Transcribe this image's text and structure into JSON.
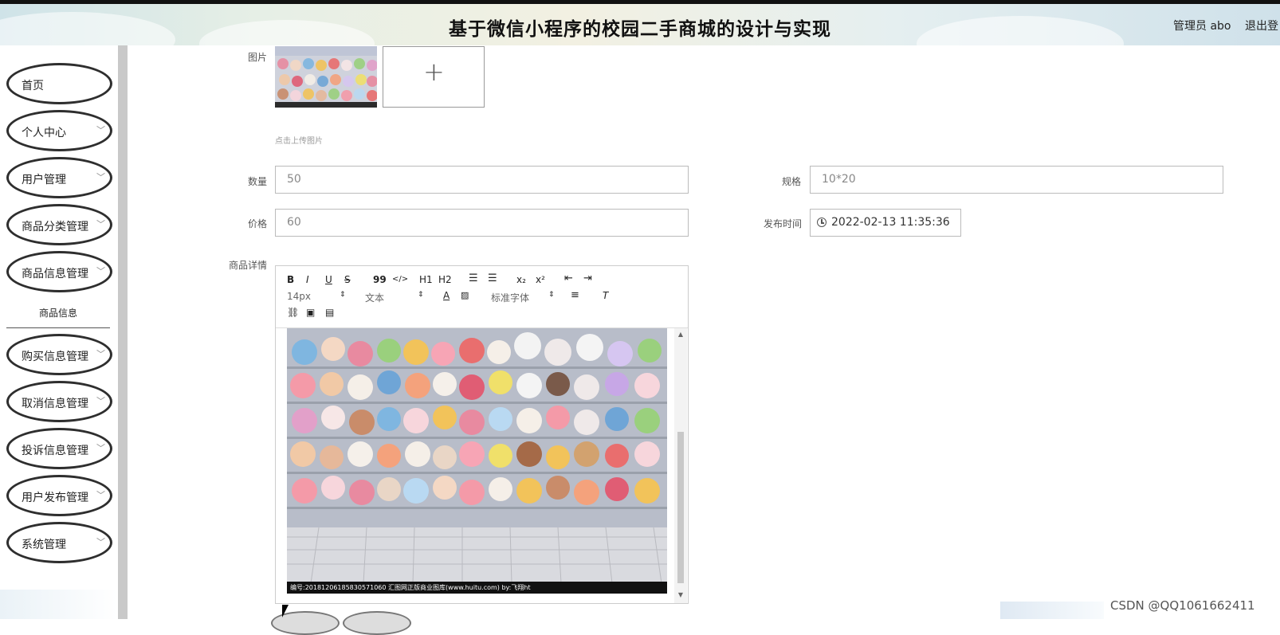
{
  "header": {
    "title": "基于微信小程序的校园二手商城的设计与实现",
    "user": "管理员 abo",
    "logout": "退出登"
  },
  "sidebar": {
    "items": [
      {
        "label": "首页",
        "chevron": false
      },
      {
        "label": "个人中心",
        "chevron": true
      },
      {
        "label": "用户管理",
        "chevron": true
      },
      {
        "label": "商品分类管理",
        "chevron": true
      },
      {
        "label": "商品信息管理",
        "chevron": true
      },
      {
        "label": "购买信息管理",
        "chevron": true
      },
      {
        "label": "取消信息管理",
        "chevron": true
      },
      {
        "label": "投诉信息管理",
        "chevron": true
      },
      {
        "label": "用户发布管理",
        "chevron": true
      },
      {
        "label": "系统管理",
        "chevron": true
      }
    ],
    "subitem": "商品信息",
    "chevron_glyph": "﹀"
  },
  "form": {
    "image_label": "图片",
    "upload_plus": "+",
    "upload_hint": "点击上传图片",
    "quantity_label": "数量",
    "quantity_value": "50",
    "spec_label": "规格",
    "spec_value": "10*20",
    "price_label": "价格",
    "price_value": "60",
    "publish_time_label": "发布时间",
    "publish_time_value": "2022-02-13 11:35:36",
    "detail_label": "商品详情"
  },
  "editor": {
    "toolbar_row1": [
      "B",
      "I",
      "U",
      "S",
      "99",
      "</>",
      "H1",
      "H2",
      "ol",
      "ul",
      "x₂",
      "x²",
      "outdent",
      "indent"
    ],
    "font_size": "14px",
    "text_style": "文本",
    "font_color": "A",
    "font_family": "标准字体",
    "image_caption": "编号:20181206185830571060   汇图网正版商业图库(www.huitu.com)  by:飞翔ht"
  },
  "watermark": "CSDN @QQ1061662411",
  "colors": {
    "border": "#bbbbbb",
    "nav_border": "#2e2e2e",
    "scrollbar": "#c9c9c9"
  }
}
